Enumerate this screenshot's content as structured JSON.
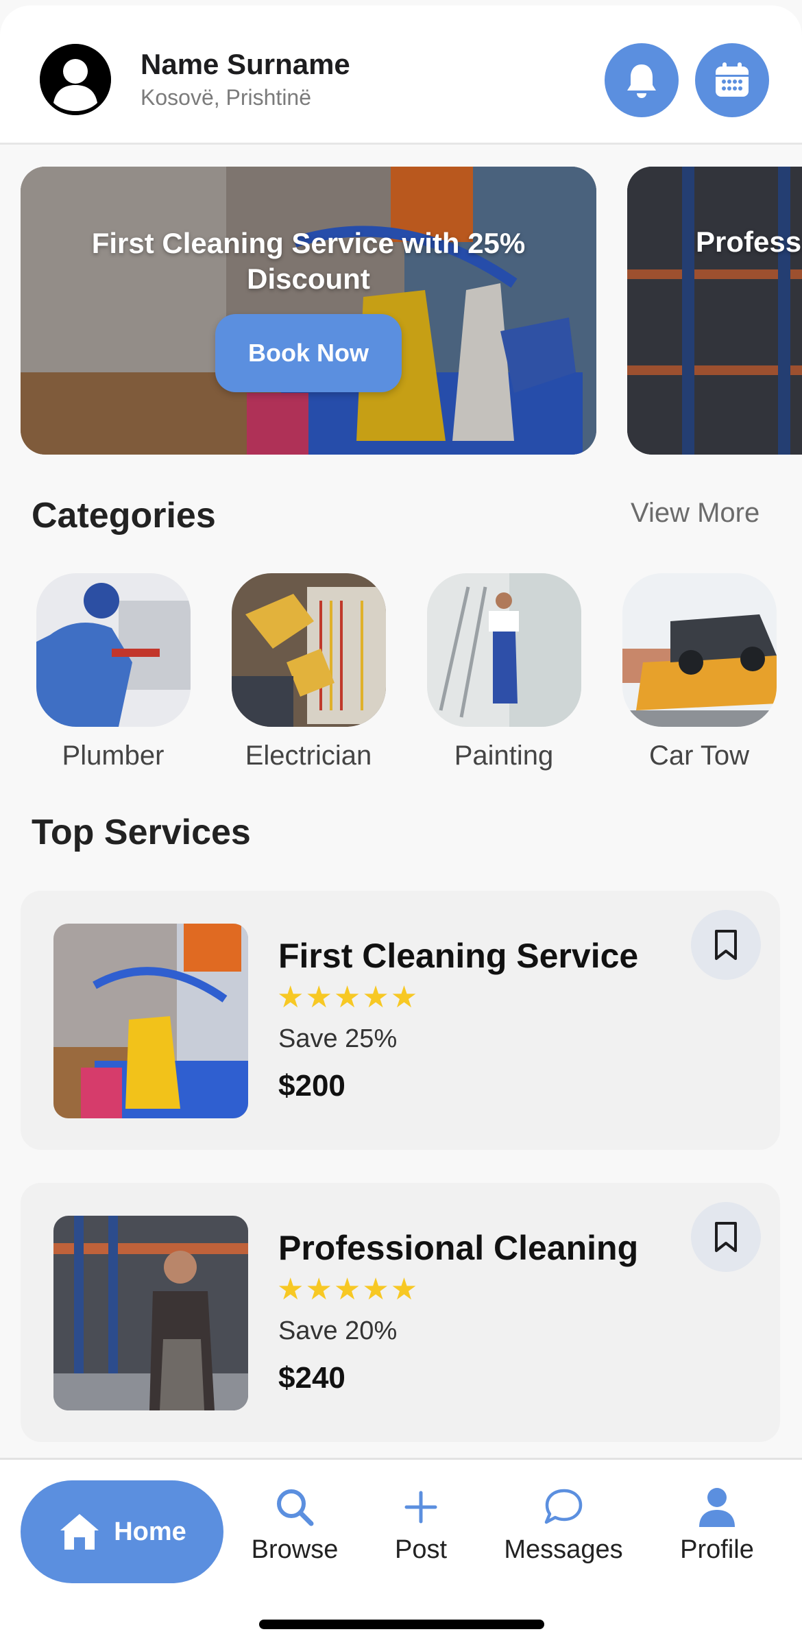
{
  "header": {
    "user_name": "Name Surname",
    "location": "Kosovë, Prishtinë",
    "icons": [
      "avatar-person-icon",
      "bell-icon",
      "calendar-icon"
    ]
  },
  "promos": [
    {
      "title": "First Cleaning Service with 25% Discount",
      "button_label": "Book Now"
    },
    {
      "title": "Profess"
    }
  ],
  "categories": {
    "title": "Categories",
    "view_more": "View More",
    "items": [
      {
        "label": "Plumber"
      },
      {
        "label": "Electrician"
      },
      {
        "label": "Painting"
      },
      {
        "label": "Car Tow"
      }
    ]
  },
  "top_services": {
    "title": "Top Services",
    "items": [
      {
        "name": "First Cleaning Service",
        "rating": 5,
        "stars": "★★★★★",
        "save": "Save 25%",
        "price": "$200"
      },
      {
        "name": "Professional Cleaning",
        "rating": 5,
        "stars": "★★★★★",
        "save": "Save 20%",
        "price": "$240"
      }
    ]
  },
  "nav": {
    "home": "Home",
    "browse": "Browse",
    "post": "Post",
    "messages": "Messages",
    "profile": "Profile"
  },
  "colors": {
    "accent": "#5b8fdf",
    "star": "#f7c824",
    "background": "#f8f8f8"
  }
}
